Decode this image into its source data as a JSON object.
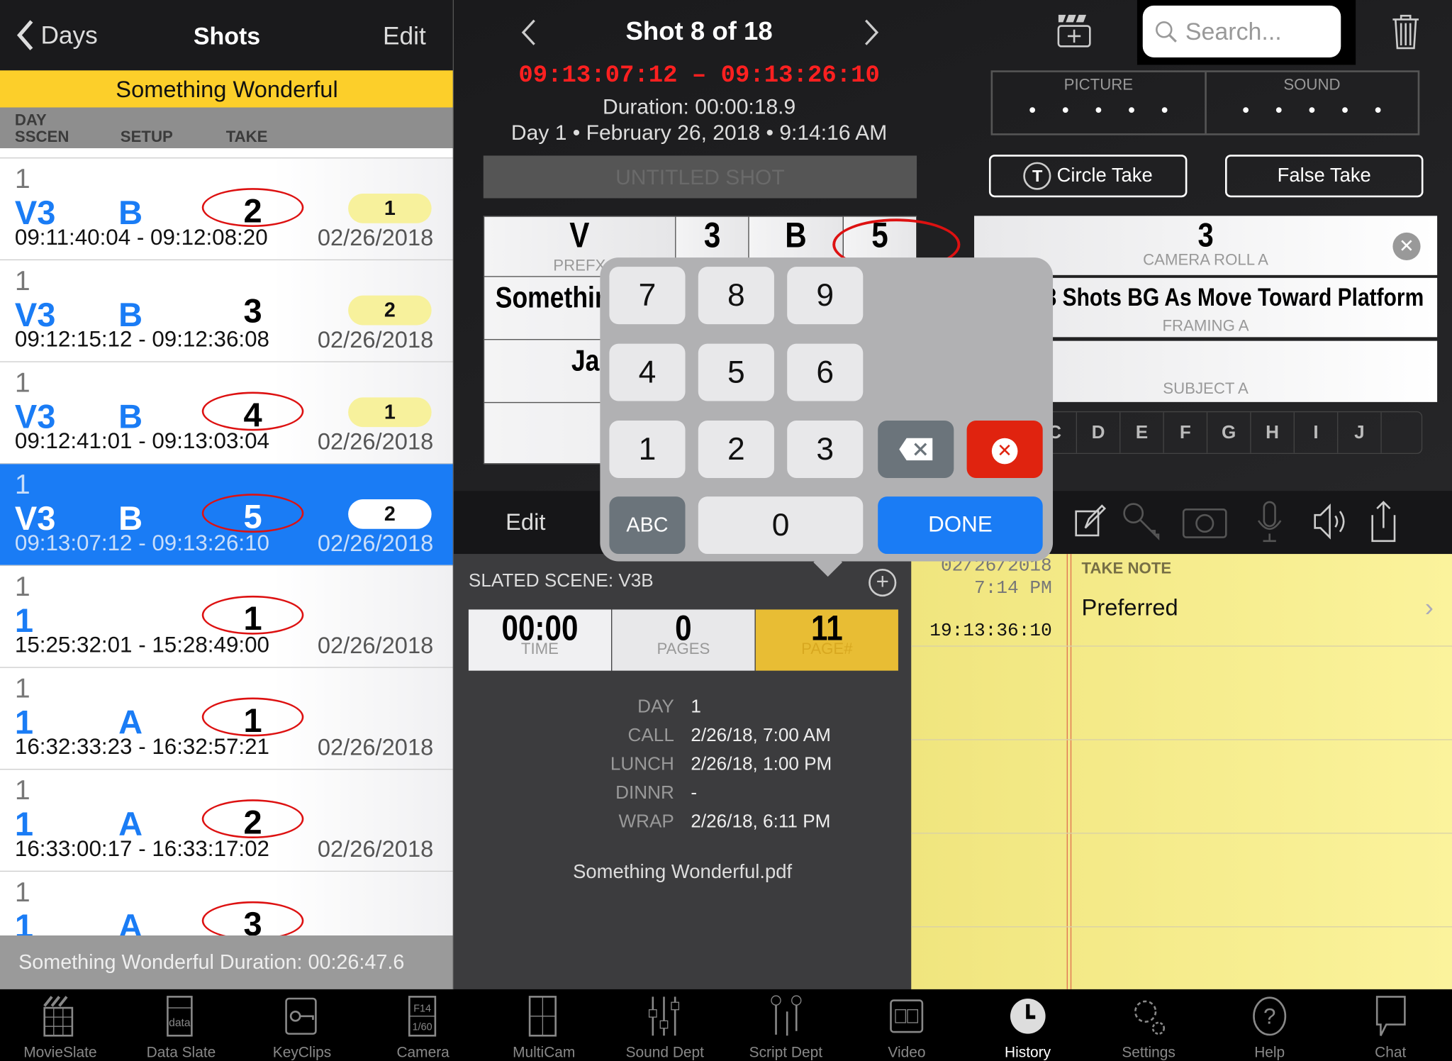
{
  "left": {
    "back_label": "Days",
    "title": "Shots",
    "edit_label": "Edit",
    "production": "Something Wonderful",
    "columns": {
      "day": "DAY",
      "scene": "SSCEN",
      "setup": "SETUP",
      "take": "TAKE"
    },
    "rows": [
      {
        "day": "1",
        "scene": "V3",
        "setup": "B",
        "take": "2",
        "circled": true,
        "badge": "1",
        "timecode": "09:11:40:04 - 09:12:08:20",
        "date": "02/26/2018"
      },
      {
        "day": "1",
        "scene": "V3",
        "setup": "B",
        "take": "3",
        "circled": false,
        "badge": "2",
        "timecode": "09:12:15:12 - 09:12:36:08",
        "date": "02/26/2018"
      },
      {
        "day": "1",
        "scene": "V3",
        "setup": "B",
        "take": "4",
        "circled": true,
        "badge": "1",
        "timecode": "09:12:41:01 - 09:13:03:04",
        "date": "02/26/2018"
      },
      {
        "day": "1",
        "scene": "V3",
        "setup": "B",
        "take": "5",
        "circled": true,
        "badge": "2",
        "timecode": "09:13:07:12 - 09:13:26:10",
        "date": "02/26/2018",
        "selected": true
      },
      {
        "day": "1",
        "scene": "1",
        "setup": "",
        "take": "1",
        "circled": true,
        "badge": "",
        "timecode": "15:25:32:01 - 15:28:49:00",
        "date": "02/26/2018"
      },
      {
        "day": "1",
        "scene": "1",
        "setup": "A",
        "take": "1",
        "circled": true,
        "badge": "",
        "timecode": "16:32:33:23 - 16:32:57:21",
        "date": "02/26/2018"
      },
      {
        "day": "1",
        "scene": "1",
        "setup": "A",
        "take": "2",
        "circled": true,
        "badge": "",
        "timecode": "16:33:00:17 - 16:33:17:02",
        "date": "02/26/2018"
      },
      {
        "day": "1",
        "scene": "1",
        "setup": "A",
        "take": "3",
        "circled": true,
        "badge": "",
        "timecode": "",
        "date": ""
      }
    ],
    "footer": "Something Wonderful Duration: 00:26:47.6"
  },
  "shot": {
    "title": "Shot 8 of 18",
    "timecode_range": "09:13:07:12 – 09:13:26:10",
    "duration": "Duration: 00:00:18.9",
    "date_line": "Day 1 • February 26, 2018 • 9:14:16 AM",
    "name_placeholder": "UNTITLED SHOT"
  },
  "slate": {
    "prefix": "V",
    "prefix_label": "PREFX",
    "scene": "3",
    "setup": "B",
    "take": "5",
    "production": "Something Wonderful",
    "row3": "Ja"
  },
  "search": {
    "placeholder": "Search..."
  },
  "picture_label": "PICTURE",
  "sound_label": "SOUND",
  "circle_take": "Circle Take",
  "false_take": "False Take",
  "camera": {
    "roll": "3",
    "roll_label": "CAMERA ROLL A",
    "framing": "g 3 Shots BG As Move Toward Platform",
    "framing_label": "FRAMING A",
    "subject_label": "SUBJECT A",
    "letters": [
      "B",
      "C",
      "D",
      "E",
      "F",
      "G",
      "H",
      "I",
      "J"
    ]
  },
  "keypad": {
    "keys": [
      "7",
      "8",
      "9",
      "4",
      "5",
      "6",
      "1",
      "2",
      "3"
    ],
    "abc": "ABC",
    "zero": "0",
    "done": "DONE"
  },
  "toolbar": {
    "edit_label": "Edit"
  },
  "lower": {
    "slated_scene": "SLATED SCENE: V3B",
    "time": "00:00",
    "time_label": "TIME",
    "pages": "0",
    "pages_label": "PAGES",
    "page_num": "11",
    "page_num_label": "PAGE#",
    "info": [
      {
        "k": "DAY",
        "v": "1"
      },
      {
        "k": "CALL",
        "v": "2/26/18, 7:00 AM"
      },
      {
        "k": "LUNCH",
        "v": "2/26/18, 1:00 PM"
      },
      {
        "k": "DINNR",
        "v": "-"
      },
      {
        "k": "WRAP",
        "v": "2/26/18, 6:11 PM"
      }
    ],
    "file": "Something Wonderful.pdf"
  },
  "note": {
    "date": "02/26/2018",
    "time": "7:14 PM",
    "timecode": "19:13:36:10",
    "label": "TAKE NOTE",
    "text": "Preferred"
  },
  "tabs": [
    {
      "label": "MovieSlate",
      "icon": "clapper-icon"
    },
    {
      "label": "Data Slate",
      "icon": "data-icon"
    },
    {
      "label": "KeyClips",
      "icon": "key-film-icon"
    },
    {
      "label": "Camera",
      "icon": "camera-settings-icon"
    },
    {
      "label": "MultiCam",
      "icon": "multicam-icon"
    },
    {
      "label": "Sound Dept",
      "icon": "mixer-icon"
    },
    {
      "label": "Script Dept",
      "icon": "script-icon"
    },
    {
      "label": "Video",
      "icon": "video-icon"
    },
    {
      "label": "History",
      "icon": "clock-icon",
      "active": true
    },
    {
      "label": "Settings",
      "icon": "gear-icon"
    },
    {
      "label": "Help",
      "icon": "help-icon"
    },
    {
      "label": "Chat",
      "icon": "chat-icon"
    }
  ],
  "colors": {
    "accent": "#1a7cf5",
    "yellow": "#fccf2a",
    "red": "#e0230f",
    "timecode_red": "#ff2020"
  }
}
